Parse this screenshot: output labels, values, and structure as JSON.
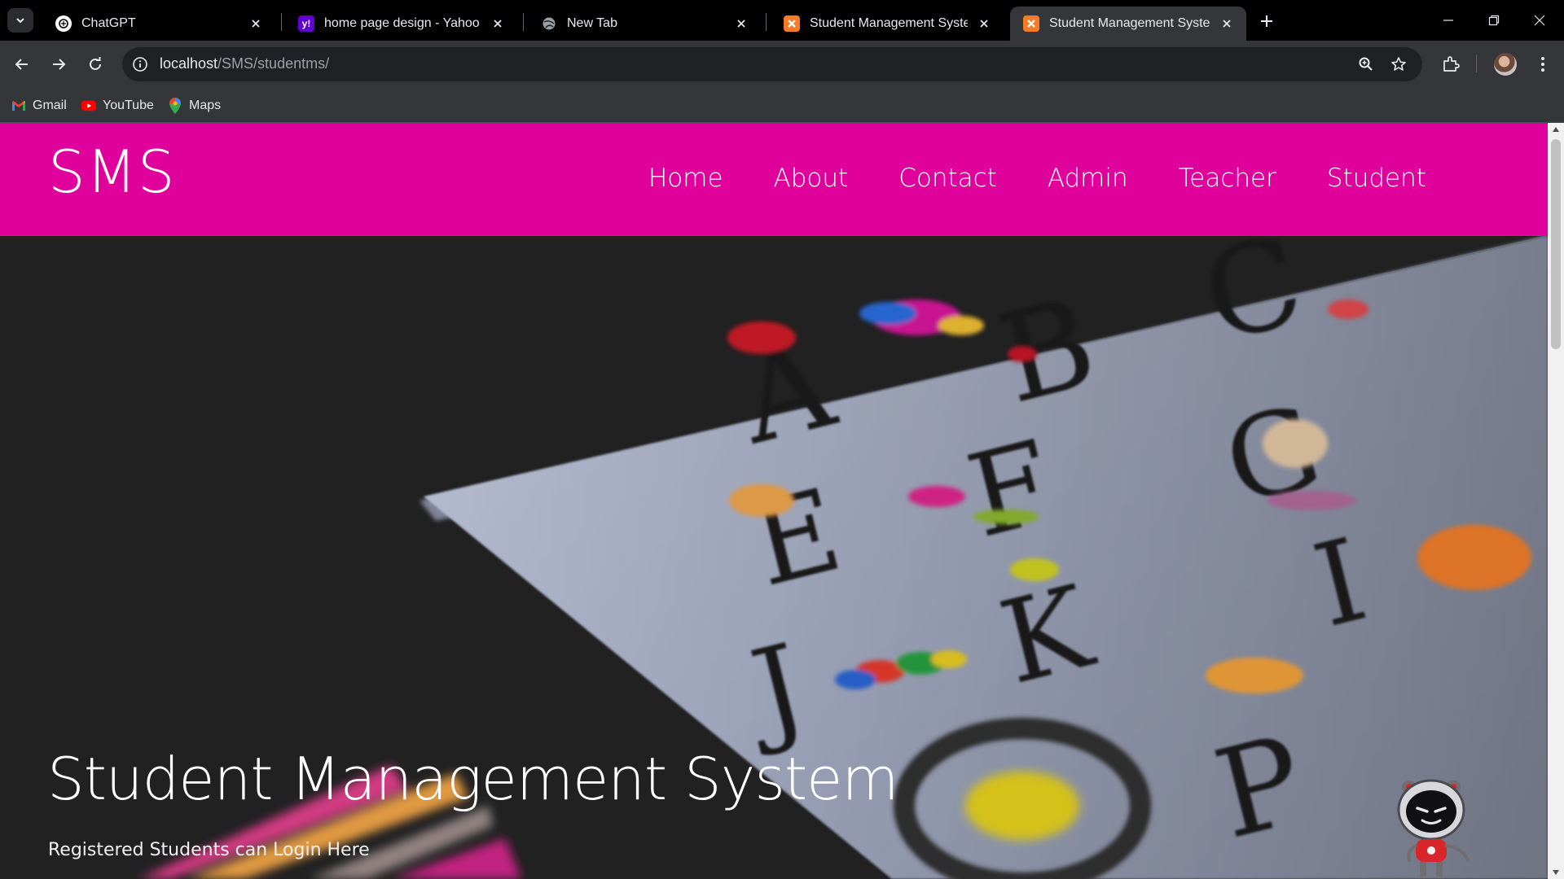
{
  "browser": {
    "tabs": [
      {
        "title": "ChatGPT",
        "favicon": "chatgpt-icon",
        "active": false
      },
      {
        "title": "home page design - Yahoo India",
        "favicon": "yahoo-icon",
        "active": false
      },
      {
        "title": "New Tab",
        "favicon": "globe-icon",
        "active": false
      },
      {
        "title": "Student Management System",
        "favicon": "xampp-icon",
        "active": false
      },
      {
        "title": "Student Management System || Home Page",
        "favicon": "xampp-icon",
        "active": true
      }
    ],
    "url_host": "localhost",
    "url_path": "/SMS/studentms/",
    "bookmarks": [
      {
        "label": "Gmail",
        "icon": "gmail-icon"
      },
      {
        "label": "YouTube",
        "icon": "youtube-icon"
      },
      {
        "label": "Maps",
        "icon": "maps-icon"
      }
    ],
    "colors": {
      "accent": "#e0009c",
      "tabstrip": "#000000",
      "toolbar": "#35363a"
    }
  },
  "site": {
    "brand": "SMS",
    "nav": [
      "Home",
      "About",
      "Contact",
      "Admin",
      "Teacher",
      "Student"
    ],
    "hero": {
      "title": "Student Management System",
      "subtitle": "Registered Students can Login Here",
      "background": "alphabet-board-photo"
    }
  }
}
